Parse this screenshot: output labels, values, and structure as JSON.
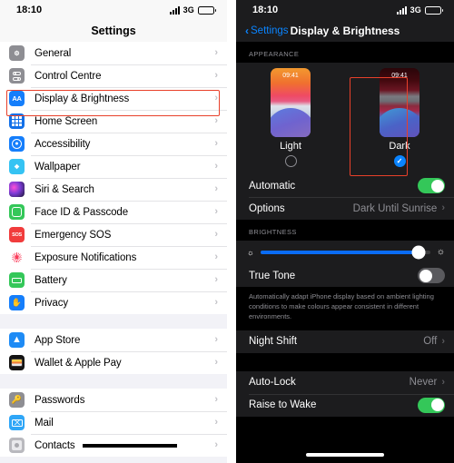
{
  "left_phone": {
    "status_bar": {
      "time": "18:10",
      "network": "3G",
      "signal_icon": "signal-bars-icon",
      "battery_icon": "battery-icon"
    },
    "header_title": "Settings",
    "groups": [
      {
        "rows": [
          {
            "label": "General",
            "icon": "gear-icon",
            "icon_class": "i-gear"
          },
          {
            "label": "Control Centre",
            "icon": "control-centre-icon",
            "icon_class": "i-cc"
          },
          {
            "label": "Display & Brightness",
            "icon": "display-brightness-icon",
            "icon_class": "i-aa",
            "highlighted": true
          },
          {
            "label": "Home Screen",
            "icon": "home-screen-icon",
            "icon_class": "i-home"
          },
          {
            "label": "Accessibility",
            "icon": "accessibility-icon",
            "icon_class": "i-acc"
          },
          {
            "label": "Wallpaper",
            "icon": "wallpaper-icon",
            "icon_class": "i-wall"
          },
          {
            "label": "Siri & Search",
            "icon": "siri-icon",
            "icon_class": "i-siri"
          },
          {
            "label": "Face ID & Passcode",
            "icon": "face-id-icon",
            "icon_class": "i-face"
          },
          {
            "label": "Emergency SOS",
            "icon": "emergency-sos-icon",
            "icon_class": "i-sos"
          },
          {
            "label": "Exposure Notifications",
            "icon": "exposure-notifications-icon",
            "icon_class": "i-exp"
          },
          {
            "label": "Battery",
            "icon": "battery-icon",
            "icon_class": "i-batt"
          },
          {
            "label": "Privacy",
            "icon": "privacy-hand-icon",
            "icon_class": "i-priv"
          }
        ]
      },
      {
        "rows": [
          {
            "label": "App Store",
            "icon": "app-store-icon",
            "icon_class": "i-apps"
          },
          {
            "label": "Wallet & Apple Pay",
            "icon": "wallet-icon",
            "icon_class": "i-wallet"
          }
        ]
      },
      {
        "rows": [
          {
            "label": "Passwords",
            "icon": "passwords-key-icon",
            "icon_class": "i-pass"
          },
          {
            "label": "Mail",
            "icon": "mail-icon",
            "icon_class": "i-mail"
          },
          {
            "label": "Contacts",
            "icon": "contacts-icon",
            "icon_class": "i-cont",
            "redacted": true
          }
        ]
      }
    ],
    "chevron": "›",
    "highlight_color": "#e8402a"
  },
  "right_phone": {
    "status_bar": {
      "time": "18:10",
      "network": "3G"
    },
    "nav": {
      "back_label": "Settings",
      "back_chevron": "‹",
      "title": "Display & Brightness"
    },
    "appearance": {
      "section_header": "APPEARANCE",
      "options": [
        {
          "name": "Light",
          "preview_time": "09:41",
          "selected": false
        },
        {
          "name": "Dark",
          "preview_time": "09:41",
          "selected": true,
          "highlighted": true
        }
      ],
      "check_glyph": "✓",
      "rows": [
        {
          "label": "Automatic",
          "type": "toggle",
          "state": "on"
        },
        {
          "label": "Options",
          "type": "value",
          "value": "Dark Until Sunrise"
        }
      ]
    },
    "brightness": {
      "section_header": "BRIGHTNESS",
      "slider": {
        "name": "brightness-slider",
        "value_percent": 93,
        "low_icon": "sun-small-icon",
        "high_icon": "sun-large-icon"
      },
      "true_tone": {
        "label": "True Tone",
        "state": "off"
      },
      "true_tone_footnote": "Automatically adapt iPhone display based on ambient lighting conditions to make colours appear consistent in different environments.",
      "night_shift": {
        "label": "Night Shift",
        "value": "Off"
      }
    },
    "lock": {
      "rows": [
        {
          "label": "Auto-Lock",
          "type": "value",
          "value": "Never"
        },
        {
          "label": "Raise to Wake",
          "type": "toggle",
          "state": "on"
        }
      ]
    },
    "chevron": "›",
    "accent_blue": "#0a84ff",
    "toggle_on_color": "#34c759",
    "highlight_color": "#e8402a"
  }
}
